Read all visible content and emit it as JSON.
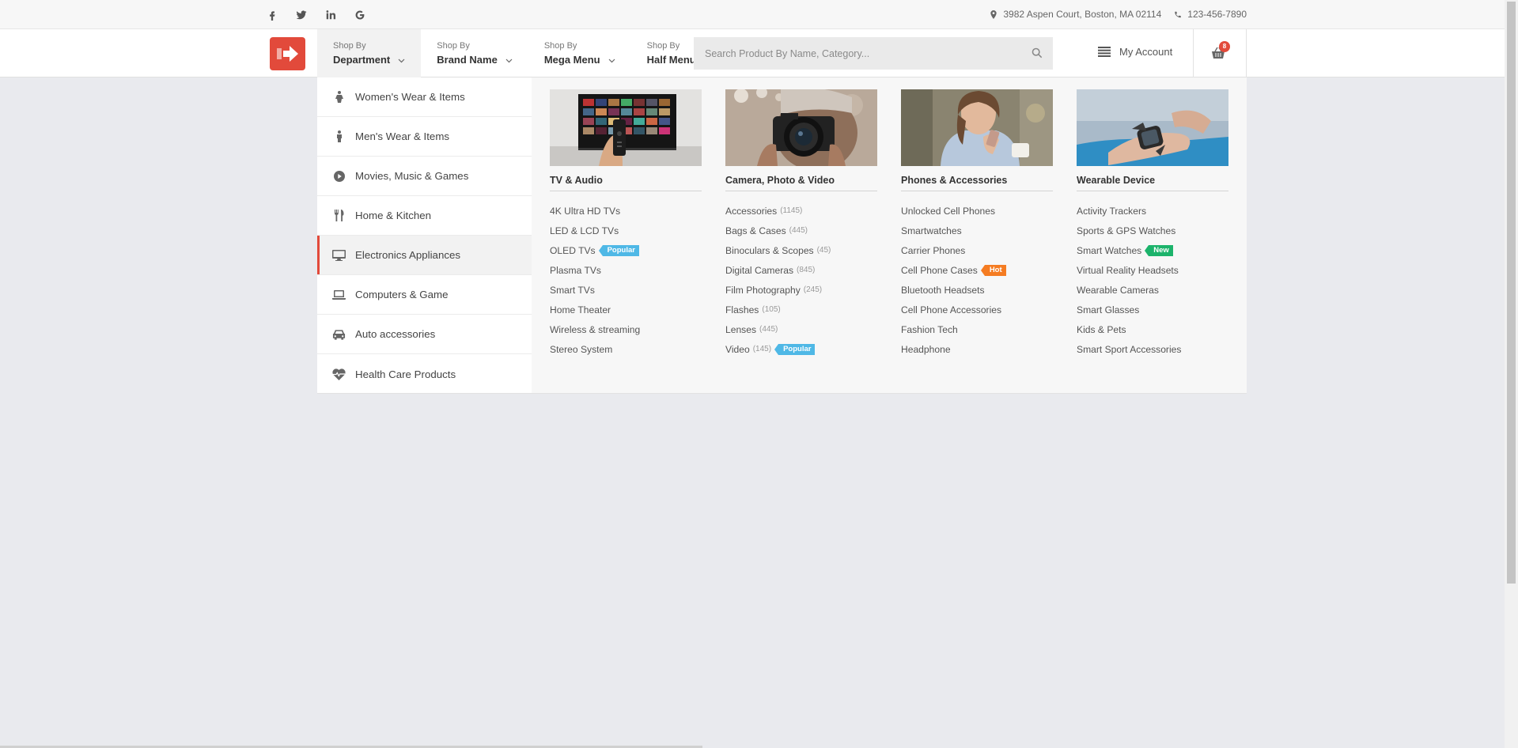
{
  "topbar": {
    "social": [
      "facebook-icon",
      "twitter-icon",
      "linkedin-icon",
      "google-icon"
    ],
    "address": "3982 Aspen Court, Boston, MA 02114",
    "phone": "123-456-7890"
  },
  "header": {
    "nav": [
      {
        "small": "Shop By",
        "big": "Department"
      },
      {
        "small": "Shop By",
        "big": "Brand Name"
      },
      {
        "small": "Shop By",
        "big": "Mega Menu"
      },
      {
        "small": "Shop By",
        "big": "Half Menu"
      }
    ],
    "search_placeholder": "Search Product By Name, Category...",
    "account_label": "My Account",
    "cart_count": "8"
  },
  "departments": [
    {
      "label": "Women's Wear & Items",
      "icon": "female-icon"
    },
    {
      "label": "Men's Wear & Items",
      "icon": "male-icon"
    },
    {
      "label": "Movies, Music & Games",
      "icon": "play-icon"
    },
    {
      "label": "Home & Kitchen",
      "icon": "cutlery-icon"
    },
    {
      "label": "Electronics Appliances",
      "icon": "desktop-icon"
    },
    {
      "label": "Computers & Game",
      "icon": "laptop-icon"
    },
    {
      "label": "Auto accessories",
      "icon": "car-icon"
    },
    {
      "label": "Health Care Products",
      "icon": "heartbeat-icon"
    }
  ],
  "mega": {
    "columns": [
      {
        "title": "TV & Audio",
        "links": [
          {
            "label": "4K Ultra HD TVs"
          },
          {
            "label": "LED & LCD TVs"
          },
          {
            "label": "OLED TVs",
            "tag": "Popular"
          },
          {
            "label": "Plasma TVs"
          },
          {
            "label": "Smart TVs"
          },
          {
            "label": "Home Theater"
          },
          {
            "label": "Wireless & streaming"
          },
          {
            "label": "Stereo System"
          }
        ]
      },
      {
        "title": "Camera, Photo & Video",
        "links": [
          {
            "label": "Accessories",
            "count": "(1145)"
          },
          {
            "label": "Bags & Cases",
            "count": "(445)"
          },
          {
            "label": "Binoculars & Scopes",
            "count": "(45)"
          },
          {
            "label": "Digital Cameras",
            "count": "(845)"
          },
          {
            "label": "Film Photography",
            "count": "(245)"
          },
          {
            "label": "Flashes",
            "count": "(105)"
          },
          {
            "label": "Lenses",
            "count": "(445)"
          },
          {
            "label": "Video",
            "count": "(145)",
            "tag": "Popular"
          }
        ]
      },
      {
        "title": "Phones & Accessories",
        "links": [
          {
            "label": "Unlocked Cell Phones"
          },
          {
            "label": "Smartwatches"
          },
          {
            "label": "Carrier Phones"
          },
          {
            "label": "Cell Phone Cases",
            "tag": "Hot"
          },
          {
            "label": "Bluetooth Headsets"
          },
          {
            "label": "Cell Phone Accessories"
          },
          {
            "label": "Fashion Tech"
          },
          {
            "label": "Headphone"
          }
        ]
      },
      {
        "title": "Wearable Device",
        "links": [
          {
            "label": "Activity Trackers"
          },
          {
            "label": "Sports & GPS Watches"
          },
          {
            "label": "Smart Watches",
            "tag": "New"
          },
          {
            "label": "Virtual Reality Headsets"
          },
          {
            "label": "Wearable Cameras"
          },
          {
            "label": "Smart Glasses"
          },
          {
            "label": "Kids & Pets"
          },
          {
            "label": "Smart Sport Accessories"
          }
        ]
      }
    ]
  },
  "colors": {
    "accent": "#e24a3b",
    "tag_popular": "#4fb8e6",
    "tag_hot": "#f57c22",
    "tag_new": "#1cb36b"
  }
}
